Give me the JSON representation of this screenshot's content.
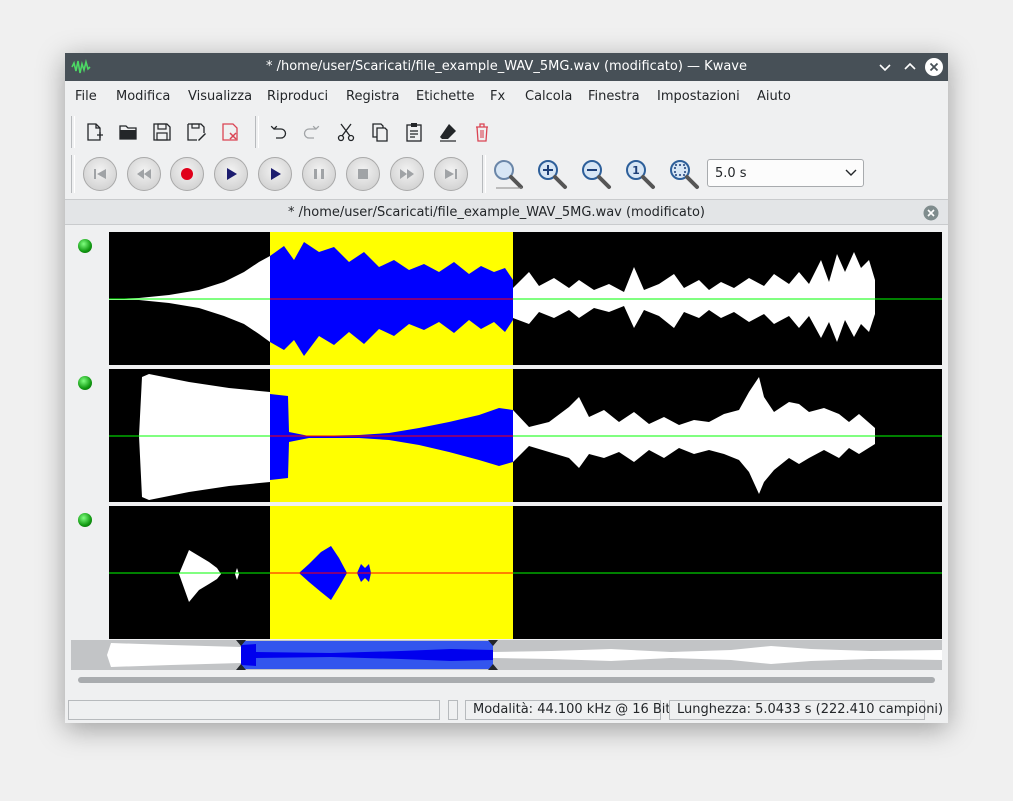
{
  "window": {
    "title": "* /home/user/Scaricati/file_example_WAV_5MG.wav (modificato) — Kwave"
  },
  "menubar": {
    "items": [
      "File",
      "Modifica",
      "Visualizza",
      "Riproduci",
      "Registra",
      "Etichette",
      "Fx",
      "Calcola",
      "Finestra",
      "Impostazioni",
      "Aiuto"
    ]
  },
  "toolbar": {
    "edit_icons": [
      "new-file-icon",
      "open-folder-icon",
      "save-icon",
      "save-as-icon",
      "close-file-icon",
      "undo-icon",
      "redo-icon",
      "cut-icon",
      "copy-icon",
      "paste-icon",
      "erase-icon",
      "delete-icon"
    ],
    "playback_icons": [
      "skip-to-start-icon",
      "rewind-icon",
      "record-icon",
      "play-icon",
      "loop-play-icon",
      "pause-icon",
      "stop-icon",
      "forward-icon",
      "skip-to-end-icon"
    ],
    "zoom_icons": [
      "zoom-selection-icon",
      "zoom-in-icon",
      "zoom-out-icon",
      "zoom-100-icon",
      "zoom-all-icon"
    ],
    "zoom_value": "5.0 s"
  },
  "document": {
    "tab_title": "* /home/user/Scaricati/file_example_WAV_5MG.wav (modificato)"
  },
  "statusbar": {
    "left": "",
    "middle": "",
    "mode": "Modalità: 44.100 kHz @ 16 Bit",
    "length": "Lunghezza: 5.0433 s (222.410 campioni)"
  },
  "colors": {
    "titlebar": "#475057",
    "selection": "#ffff00",
    "selected_wave": "#0000ff",
    "wave": "#ffffff",
    "track_bg": "#000000",
    "zero_line": "#00ff00",
    "selected_zero_line": "#ff0000",
    "led": "#11aa11"
  }
}
